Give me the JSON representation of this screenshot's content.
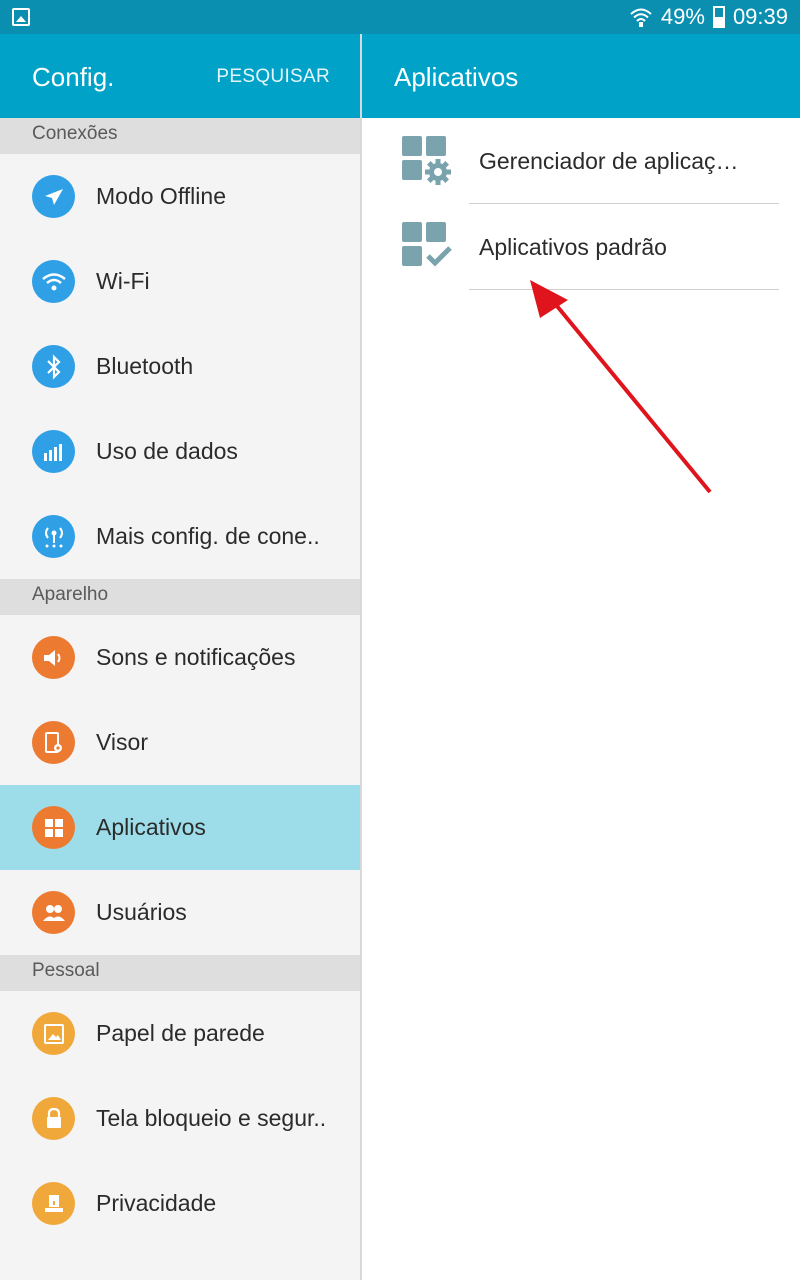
{
  "status_bar": {
    "battery": "49%",
    "time": "09:39",
    "icons": [
      "gallery-icon",
      "wifi-icon",
      "battery-icon"
    ]
  },
  "left_header": {
    "title": "Config.",
    "search_label": "PESQUISAR"
  },
  "right_header": {
    "title": "Aplicativos"
  },
  "sidebar": {
    "sections": [
      {
        "title": "Conexões",
        "items": [
          {
            "label": "Modo Offline",
            "icon": "airplane-icon",
            "color": "#2f9fe6"
          },
          {
            "label": "Wi-Fi",
            "icon": "wifi-icon",
            "color": "#2f9fe6"
          },
          {
            "label": "Bluetooth",
            "icon": "bluetooth-icon",
            "color": "#2f9fe6"
          },
          {
            "label": "Uso de dados",
            "icon": "data-usage-icon",
            "color": "#2f9fe6"
          },
          {
            "label": "Mais config. de cone..",
            "icon": "more-connections-icon",
            "color": "#2f9fe6"
          }
        ]
      },
      {
        "title": "Aparelho",
        "items": [
          {
            "label": "Sons e notificações",
            "icon": "volume-icon",
            "color": "#ec7a30"
          },
          {
            "label": "Visor",
            "icon": "display-icon",
            "color": "#ec7a30"
          },
          {
            "label": "Aplicativos",
            "icon": "apps-icon",
            "color": "#ec7a30",
            "selected": true
          },
          {
            "label": "Usuários",
            "icon": "users-icon",
            "color": "#ec7a30"
          }
        ]
      },
      {
        "title": "Pessoal",
        "items": [
          {
            "label": "Papel de parede",
            "icon": "wallpaper-icon",
            "color": "#f1a83a"
          },
          {
            "label": "Tela bloqueio e segur..",
            "icon": "lock-icon",
            "color": "#f1a83a"
          },
          {
            "label": "Privacidade",
            "icon": "privacy-icon",
            "color": "#f1a83a"
          }
        ]
      }
    ]
  },
  "apps_panel": {
    "items": [
      {
        "label": "Gerenciador de aplicaç…",
        "icon": "app-manager-gear-icon"
      },
      {
        "label": "Aplicativos padrão",
        "icon": "default-apps-check-icon"
      }
    ]
  },
  "colors": {
    "status_bar": "#0a8fb0",
    "header": "#00a2c8",
    "selected_row": "#9ddde9",
    "annotation_arrow": "#e0141c",
    "app_icon": "#7aa3ad"
  }
}
